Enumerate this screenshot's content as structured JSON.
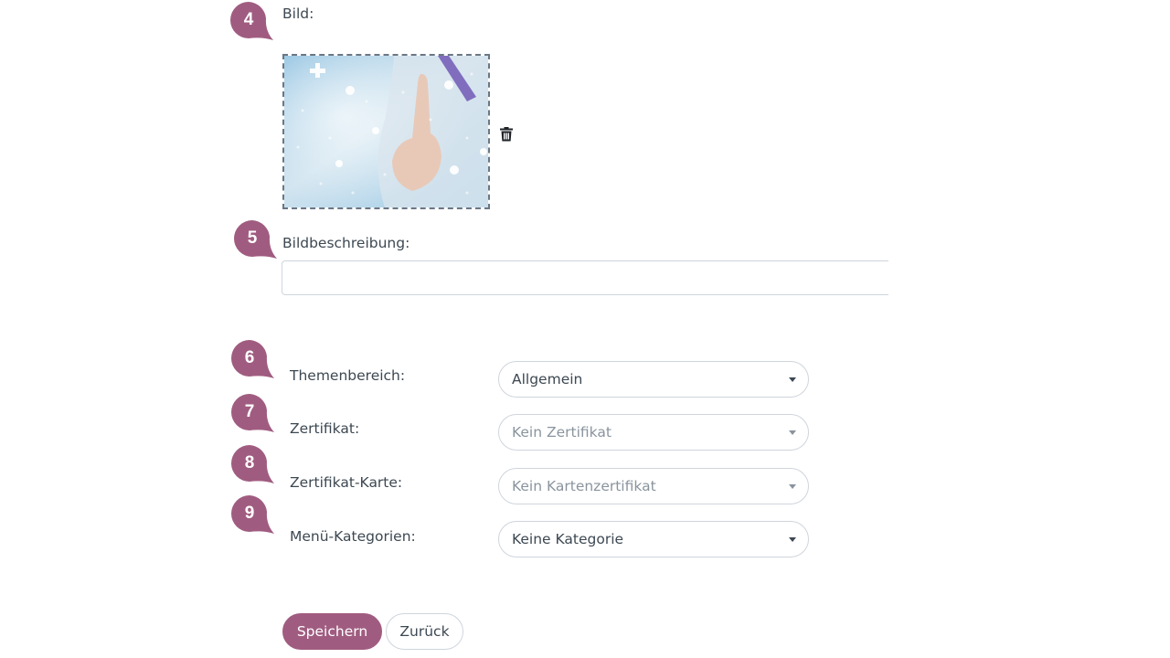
{
  "markers": {
    "m4": "4",
    "m5": "5",
    "m6": "6",
    "m7": "7",
    "m8": "8",
    "m9": "9"
  },
  "image_section": {
    "label": "Bild:"
  },
  "description": {
    "label": "Bildbeschreibung:",
    "value": ""
  },
  "fields": {
    "topic": {
      "label": "Themenbereich:",
      "value": "Allgemein"
    },
    "certificate": {
      "label": "Zertifikat:",
      "value": "Kein Zertifikat"
    },
    "certificate_card": {
      "label": "Zertifikat-Karte:",
      "value": "Kein Kartenzertifikat"
    },
    "menu_categories": {
      "label": "Menü-Kategorien:",
      "value": "Keine Kategorie"
    }
  },
  "actions": {
    "save": "Speichern",
    "back": "Zurück"
  },
  "colors": {
    "accent": "#a05c80",
    "text": "#3d4852",
    "placeholder": "#8a949e",
    "border": "#cfd5dc"
  },
  "icons": {
    "delete": "trash-icon",
    "dropdown": "caret-down-icon"
  }
}
